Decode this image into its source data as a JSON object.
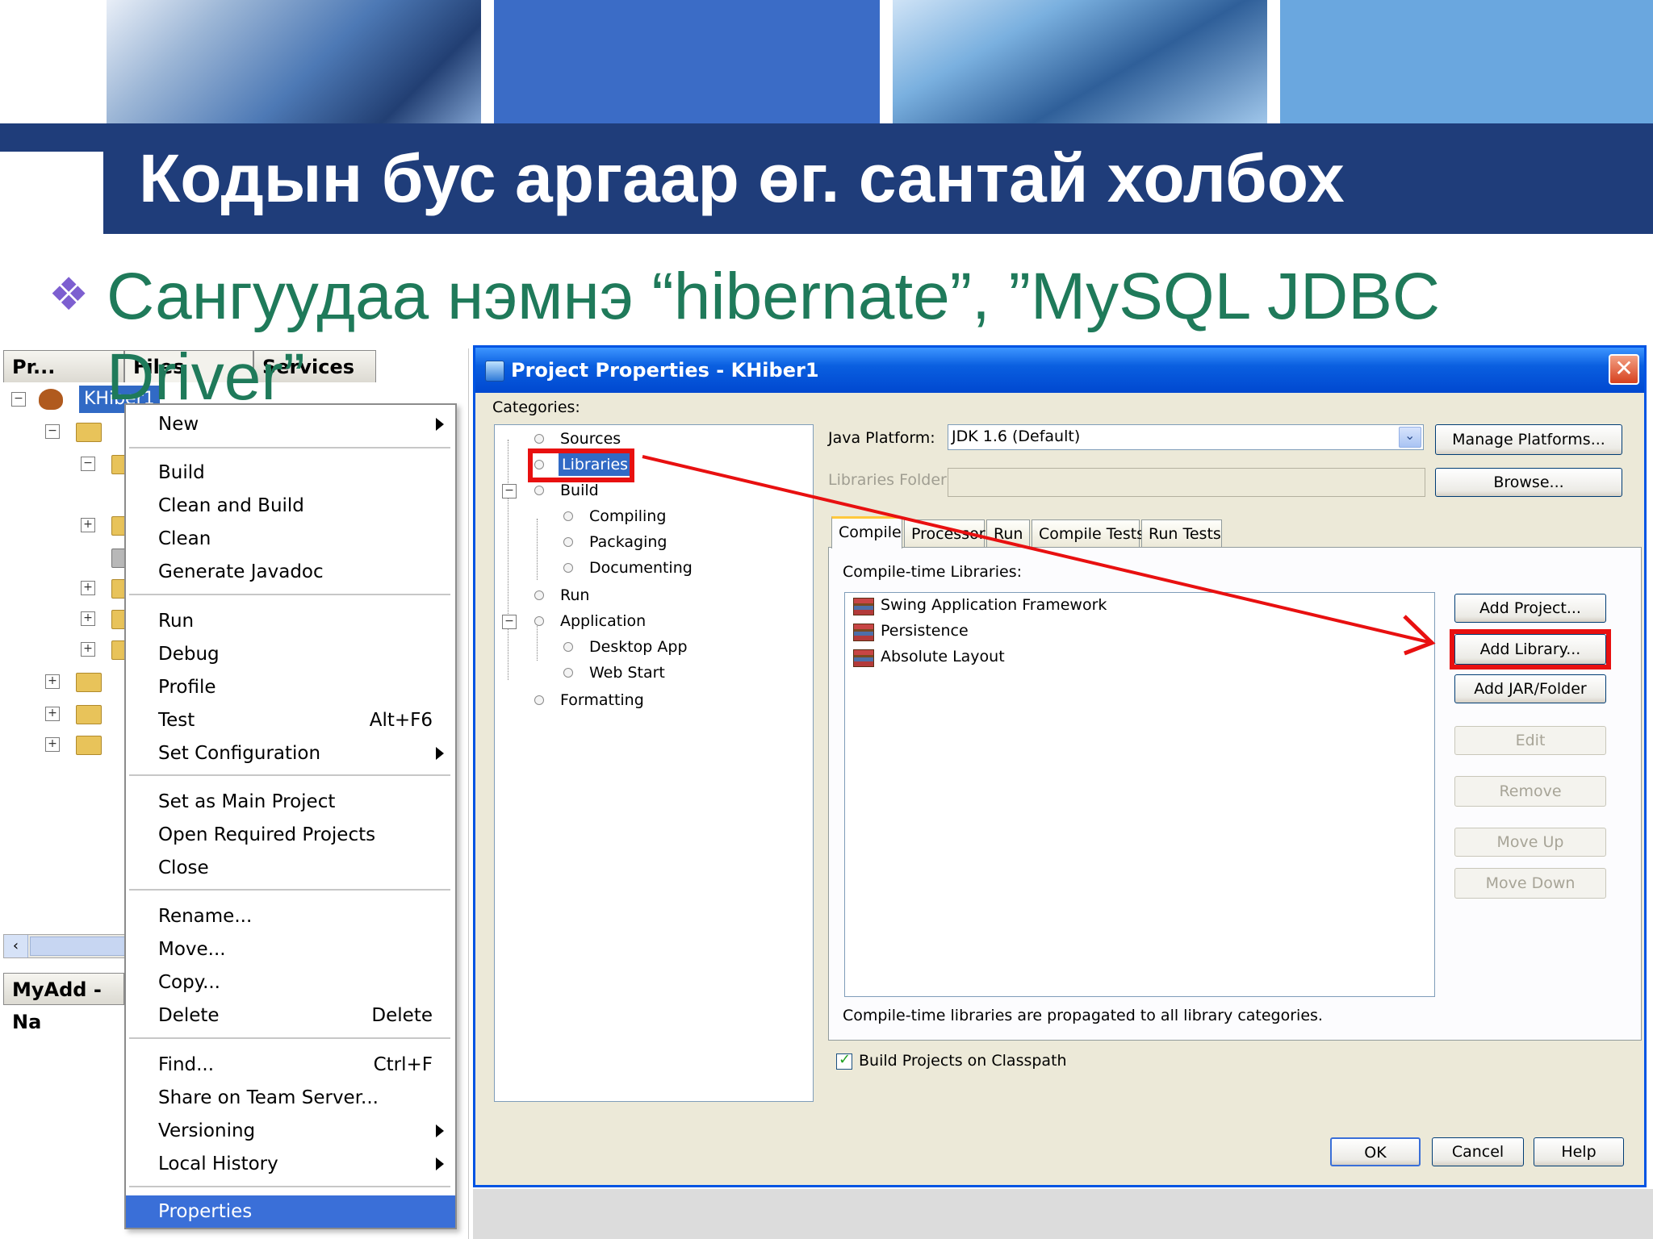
{
  "slide": {
    "title": "Кодын бус аргаар өг. сантай холбох",
    "bullet": "Сангуудаа нэмнэ  “hibernate”, ”MySQL JDBC Driver”",
    "bullet_icon": "diamond-bullet-icon"
  },
  "left_panel": {
    "tabs": [
      "Pr...",
      "Files",
      "Services"
    ],
    "project_node": "KHiber1",
    "bottom_tab": "MyAdd - Na"
  },
  "context_menu": {
    "items": [
      {
        "label": "New",
        "shortcut": "",
        "submenu": true
      },
      {
        "label": "Build",
        "shortcut": "",
        "submenu": false
      },
      {
        "label": "Clean and Build",
        "shortcut": "",
        "submenu": false
      },
      {
        "label": "Clean",
        "shortcut": "",
        "submenu": false
      },
      {
        "label": "Generate Javadoc",
        "shortcut": "",
        "submenu": false
      },
      {
        "label": "Run",
        "shortcut": "",
        "submenu": false
      },
      {
        "label": "Debug",
        "shortcut": "",
        "submenu": false
      },
      {
        "label": "Profile",
        "shortcut": "",
        "submenu": false
      },
      {
        "label": "Test",
        "shortcut": "Alt+F6",
        "submenu": false
      },
      {
        "label": "Set Configuration",
        "shortcut": "",
        "submenu": true
      },
      {
        "label": "Set as Main Project",
        "shortcut": "",
        "submenu": false
      },
      {
        "label": "Open Required Projects",
        "shortcut": "",
        "submenu": false
      },
      {
        "label": "Close",
        "shortcut": "",
        "submenu": false
      },
      {
        "label": "Rename...",
        "shortcut": "",
        "submenu": false
      },
      {
        "label": "Move...",
        "shortcut": "",
        "submenu": false
      },
      {
        "label": "Copy...",
        "shortcut": "",
        "submenu": false
      },
      {
        "label": "Delete",
        "shortcut": "Delete",
        "submenu": false
      },
      {
        "label": "Find...",
        "shortcut": "Ctrl+F",
        "submenu": false
      },
      {
        "label": "Share on Team Server...",
        "shortcut": "",
        "submenu": false
      },
      {
        "label": "Versioning",
        "shortcut": "",
        "submenu": true
      },
      {
        "label": "Local History",
        "shortcut": "",
        "submenu": true
      },
      {
        "label": "Properties",
        "shortcut": "",
        "submenu": false,
        "selected": true
      }
    ]
  },
  "dialog": {
    "title": "Project Properties - KHiber1",
    "categories_label": "Categories:",
    "categories": [
      {
        "label": "Sources",
        "level": 0
      },
      {
        "label": "Libraries",
        "level": 0,
        "selected": true
      },
      {
        "label": "Build",
        "level": 0,
        "expanded": true
      },
      {
        "label": "Compiling",
        "level": 1
      },
      {
        "label": "Packaging",
        "level": 1
      },
      {
        "label": "Documenting",
        "level": 1
      },
      {
        "label": "Run",
        "level": 0
      },
      {
        "label": "Application",
        "level": 0,
        "expanded": true
      },
      {
        "label": "Desktop App",
        "level": 1
      },
      {
        "label": "Web Start",
        "level": 1
      },
      {
        "label": "Formatting",
        "level": 0
      }
    ],
    "java_platform_label": "Java Platform:",
    "java_platform_value": "JDK 1.6 (Default)",
    "manage_platforms": "Manage Platforms...",
    "libraries_folder_label": "Libraries Folder:",
    "browse": "Browse...",
    "tabs": [
      "Compile",
      "Processor",
      "Run",
      "Compile Tests",
      "Run Tests"
    ],
    "active_tab": "Compile",
    "compile_libs_label": "Compile-time Libraries:",
    "libraries": [
      "Swing Application Framework",
      "Persistence",
      "Absolute Layout"
    ],
    "buttons": {
      "add_project": "Add Project...",
      "add_library": "Add Library...",
      "add_jar": "Add JAR/Folder",
      "edit": "Edit",
      "remove": "Remove",
      "move_up": "Move Up",
      "move_down": "Move Down"
    },
    "propagation_note": "Compile-time libraries are propagated to all library categories.",
    "build_on_classpath": "Build Projects on Classpath",
    "build_on_classpath_checked": true,
    "ok": "OK",
    "cancel": "Cancel",
    "help": "Help"
  },
  "colors": {
    "title_bar": "#1f3d7a",
    "bullet_text": "#1f7a5a",
    "annotation_red": "#e81010",
    "selection_blue": "#316ac5",
    "dialog_title": "#0a5fe0"
  }
}
